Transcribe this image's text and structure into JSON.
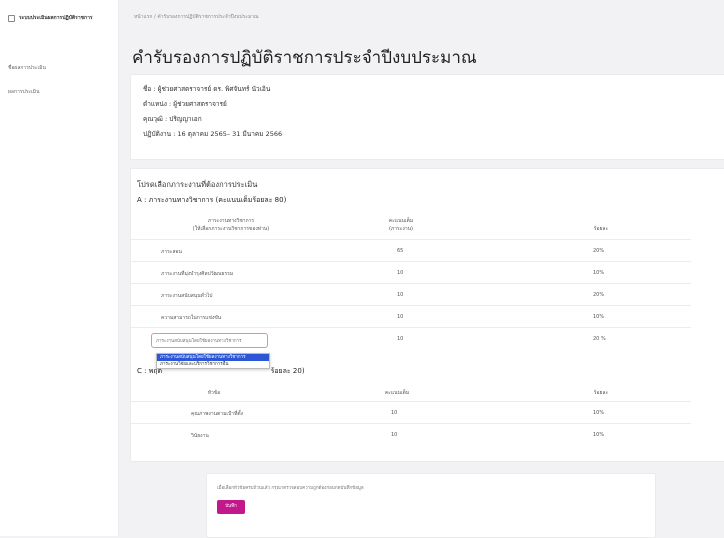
{
  "sidebar": {
    "brand": "ระบบประเมินผลการปฏิบัติราชการ",
    "items": [
      {
        "label": "ชื่อผลการประเมิน"
      },
      {
        "label": "ผลการประเมิน"
      }
    ]
  },
  "breadcrumb": "หน้าแรก / คำรับรองการปฏิบัติราชการประจำปีงบประมาณ",
  "page_title": "คำรับรองการปฏิบัติราชการประจำปีงบประมาณ",
  "info": {
    "name": "ชื่อ : ผู้ช่วยศาสตราจารย์ ดร. พิศจันทร์ นัวเอิน",
    "position": "ตำแหน่ง : ผู้ช่วยศาสตราจารย์",
    "degree": "คุณวุฒิ : ปริญญาเอก",
    "period": "ปฏิบัติงาน : 16 ตุลาคม 2565– 31 มีนาคม 2566"
  },
  "evaluation": {
    "heading": "โปรดเลือกภาระงานที่ต้องการประเมิน",
    "section_a": {
      "title": "A : ภาระงานทางวิชาการ (คะแนนเต็มร้อยละ 80)",
      "col1": [
        "ภาระงานทางวิชาการ",
        "(ให้เลือกภาระงานวิชาการของท่าน)"
      ],
      "col2": [
        "คะแนนเต็ม",
        "(ภาระงาน)"
      ],
      "col3": "ร้อยละ",
      "rows": [
        {
          "item": "ภาระสอน",
          "score": "65",
          "percent": "20%"
        },
        {
          "item": "ภาระงานที่มุ่งบำรุงศิลปวัฒนธรรม",
          "score": "10",
          "percent": "10%"
        },
        {
          "item": "ภาระงานสนับสนุนทั่วไป",
          "score": "10",
          "percent": "20%"
        },
        {
          "item": "ความสามารถในการแข่งขัน",
          "score": "10",
          "percent": "10%"
        },
        {
          "item": "",
          "score": "10",
          "percent": "20 %"
        }
      ]
    },
    "dropdown": {
      "value": "ภาระงานสนับสนุนโดยใช้ผลงานทางวิชาการ",
      "options": [
        "ภาระงานสนับสนุนโดยใช้ผลงานทางวิชาการ",
        "ภาระงานวิจัยและบริการวิชาการอื่น"
      ]
    },
    "section_c": {
      "title": "C : พฤติ",
      "title_end": "ร้อยละ 20)",
      "col1": "หัวข้อ",
      "col2": "คะแนนเต็ม",
      "col3": "ร้อยละ",
      "rows": [
        {
          "item": "คุณภาพงานตามเป้าที่ตั้ง",
          "score": "10",
          "percent": "10%"
        },
        {
          "item": "วินัยงาน",
          "score": "10",
          "percent": "10%"
        }
      ]
    }
  },
  "footer": {
    "message": "เมื่อเลือกหัวข้อครบถ้วนแล้ว กรุณาตรวจสอบความถูกต้องก่อนกดบันทึกข้อมูล",
    "save_label": "บันทึก"
  },
  "colors": {
    "accent": "#c2188b",
    "select_highlight": "#2b57d6"
  }
}
